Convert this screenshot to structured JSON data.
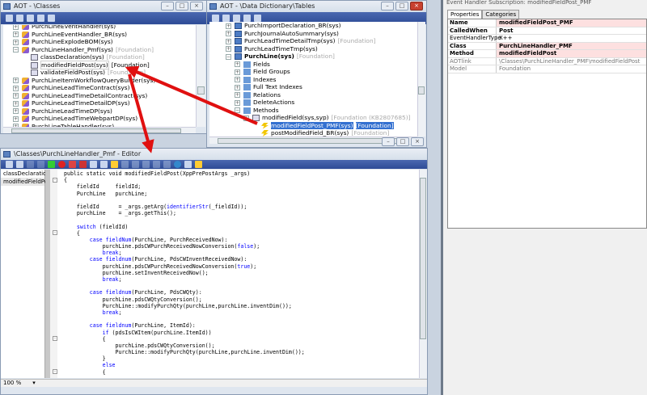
{
  "classes_window": {
    "title": "AOT - \\Classes",
    "items": [
      {
        "label": "PurchLineEventHandler(sys)",
        "layer": "",
        "level": 0,
        "type": "class",
        "expand": "+"
      },
      {
        "label": "PurchLineEventHandler_BR(sys)",
        "layer": "",
        "level": 0,
        "type": "class",
        "expand": "+"
      },
      {
        "label": "PurchLineExplodeBOM(sys)",
        "layer": "",
        "level": 0,
        "type": "class",
        "expand": "+"
      },
      {
        "label": "PurchLineHandler_Pmf(sys)",
        "layer": "[Foundation]",
        "level": 0,
        "type": "class",
        "expand": "-"
      },
      {
        "label": "classDeclaration(sys)",
        "layer": "[Foundation]",
        "level": 1,
        "type": "method",
        "expand": ""
      },
      {
        "label": "modifiedFieldPost(sys)",
        "layer": "[Foundation]",
        "level": 1,
        "type": "method",
        "expand": "",
        "highlight": true
      },
      {
        "label": "validateFieldPost(sys)",
        "layer": "[Foundation]",
        "level": 1,
        "type": "method",
        "expand": ""
      },
      {
        "label": "PurchLineItemWorkflowQueryBuilder(sys)",
        "layer": "",
        "level": 0,
        "type": "class",
        "expand": "+"
      },
      {
        "label": "PurchLineLeadTimeContract(sys)",
        "layer": "",
        "level": 0,
        "type": "class",
        "expand": "+"
      },
      {
        "label": "PurchLineLeadTimeDetailContract(sys)",
        "layer": "",
        "level": 0,
        "type": "class",
        "expand": "+"
      },
      {
        "label": "PurchLineLeadTimeDetailDP(sys)",
        "layer": "",
        "level": 0,
        "type": "class",
        "expand": "+"
      },
      {
        "label": "PurchLineLeadTimeDP(sys)",
        "layer": "",
        "level": 0,
        "type": "class",
        "expand": "+"
      },
      {
        "label": "PurchLineLeadTimeWebpartDP(sys)",
        "layer": "",
        "level": 0,
        "type": "class",
        "expand": "+"
      },
      {
        "label": "PurchLineTableHandler(sys)",
        "layer": "",
        "level": 0,
        "type": "class",
        "expand": "+"
      }
    ]
  },
  "tables_window": {
    "title": "AOT - \\Data Dictionary\\Tables",
    "items": [
      {
        "label": "PurchImportDeclaration_BR(sys)",
        "layer": "",
        "level": 0,
        "type": "table",
        "expand": "+"
      },
      {
        "label": "PurchJournalAutoSummary(sys)",
        "layer": "",
        "level": 0,
        "type": "table",
        "expand": "+"
      },
      {
        "label": "PurchLeadTimeDetailTmp(sys)",
        "layer": "[Foundation]",
        "level": 0,
        "type": "table",
        "expand": "+"
      },
      {
        "label": "PurchLeadTimeTmp(sys)",
        "layer": "",
        "level": 0,
        "type": "table",
        "expand": "+"
      },
      {
        "label": "PurchLine(sys)",
        "layer": "[Foundation]",
        "level": 0,
        "type": "table",
        "expand": "-",
        "bold": true
      },
      {
        "label": "Fields",
        "layer": "",
        "level": 1,
        "type": "node",
        "expand": "+"
      },
      {
        "label": "Field Groups",
        "layer": "",
        "level": 1,
        "type": "node",
        "expand": "+"
      },
      {
        "label": "Indexes",
        "layer": "",
        "level": 1,
        "type": "node",
        "expand": "+"
      },
      {
        "label": "Full Text Indexes",
        "layer": "",
        "level": 1,
        "type": "node",
        "expand": "+"
      },
      {
        "label": "Relations",
        "layer": "",
        "level": 1,
        "type": "node",
        "expand": "+"
      },
      {
        "label": "DeleteActions",
        "layer": "",
        "level": 1,
        "type": "node",
        "expand": "+"
      },
      {
        "label": "Methods",
        "layer": "",
        "level": 1,
        "type": "node",
        "expand": "-"
      },
      {
        "label": "modifiedField(sys,syp)",
        "layer": "[Foundation (KB2807685)]",
        "level": 2,
        "type": "method",
        "expand": "+"
      },
      {
        "label": "modifiedFieldPost_PMF(sys)",
        "layer": "[Foundation]",
        "level": 3,
        "type": "event",
        "expand": "",
        "selected": true
      },
      {
        "label": "postModifiedField_BR(sys)",
        "layer": "[Foundation]",
        "level": 3,
        "type": "event",
        "expand": ""
      }
    ]
  },
  "properties": {
    "title": "Event Handler Subscription: modifiedFieldPost_PMF",
    "tabs": [
      "Properties",
      "Categories"
    ],
    "rows": [
      {
        "key": "Name",
        "value": "modifiedFieldPost_PMF",
        "style": "pink"
      },
      {
        "key": "CalledWhen",
        "value": "Post",
        "style": "bold"
      },
      {
        "key": "EventHandlerType",
        "value": "X++",
        "style": ""
      },
      {
        "key": "Class",
        "value": "PurchLineHandler_PMF",
        "style": "pink"
      },
      {
        "key": "Method",
        "value": "modifiedFieldPost",
        "style": "pink"
      },
      {
        "key": "AOTlink",
        "value": "\\Classes\\PurchLineHandler_PMF\\modifiedFieldPost",
        "style": "grey"
      },
      {
        "key": "Model",
        "value": "Foundation",
        "style": "grey"
      }
    ]
  },
  "editor": {
    "title": "\\Classes\\PurchLineHandler_Pmf - Editor",
    "methods": [
      "classDeclaration",
      "modifiedFieldPost"
    ],
    "zoom": "100 %",
    "code": [
      [
        [
          "",
          "public static void modifiedFieldPost(XppPrePostArgs _args)"
        ]
      ],
      [
        [
          "",
          "{"
        ]
      ],
      [
        [
          "",
          "    fieldId     fieldId;"
        ]
      ],
      [
        [
          "",
          "    PurchLine   purchLine;"
        ]
      ],
      [
        [
          "",
          ""
        ]
      ],
      [
        [
          "",
          "    fieldId      = _args.getArg("
        ],
        [
          "kw",
          "identifierStr"
        ],
        [
          "",
          "(_fieldId));"
        ]
      ],
      [
        [
          "",
          "    purchLine    = _args.getThis();"
        ]
      ],
      [
        [
          "",
          ""
        ]
      ],
      [
        [
          "kw",
          "    switch"
        ],
        [
          "",
          " (fieldId)"
        ]
      ],
      [
        [
          "",
          "    {"
        ]
      ],
      [
        [
          "kw",
          "        case fieldNum"
        ],
        [
          "",
          "(PurchLine, PurchReceivedNow):"
        ]
      ],
      [
        [
          "",
          "            purchLine.pdsCWPurchReceivedNowConversion("
        ],
        [
          "kw",
          "false"
        ],
        [
          "",
          ");"
        ]
      ],
      [
        [
          "kw",
          "            break"
        ],
        [
          "",
          ";"
        ]
      ],
      [
        [
          "kw",
          "        case fieldnum"
        ],
        [
          "",
          "(PurchLine, PdsCWInventReceivedNow):"
        ]
      ],
      [
        [
          "",
          "            purchLine.pdsCWPurchReceivedNowConversion("
        ],
        [
          "kw",
          "true"
        ],
        [
          "",
          ");"
        ]
      ],
      [
        [
          "",
          "            purchLine.setInventReceivedNow();"
        ]
      ],
      [
        [
          "kw",
          "            break"
        ],
        [
          "",
          ";"
        ]
      ],
      [
        [
          "",
          ""
        ]
      ],
      [
        [
          "kw",
          "        case fieldnum"
        ],
        [
          "",
          "(PurchLine, PdsCWQty):"
        ]
      ],
      [
        [
          "",
          "            purchLine.pdsCWQtyConversion();"
        ]
      ],
      [
        [
          "",
          "            PurchLine::modifyPurchQty(purchLine,purchLine.inventDim());"
        ]
      ],
      [
        [
          "kw",
          "            break"
        ],
        [
          "",
          ";"
        ]
      ],
      [
        [
          "",
          ""
        ]
      ],
      [
        [
          "kw",
          "        case fieldnum"
        ],
        [
          "",
          "(PurchLine, ItemId):"
        ]
      ],
      [
        [
          "kw",
          "            if"
        ],
        [
          "",
          " (pdsIsCWItem(purchLine.ItemId))"
        ]
      ],
      [
        [
          "",
          "            {"
        ]
      ],
      [
        [
          "",
          "                purchLine.pdsCWQtyConversion();"
        ]
      ],
      [
        [
          "",
          "                PurchLine::modifyPurchQty(purchLine,purchLine.inventDim());"
        ]
      ],
      [
        [
          "",
          "            }"
        ]
      ],
      [
        [
          "kw",
          "            else"
        ]
      ],
      [
        [
          "",
          "            {"
        ]
      ]
    ]
  },
  "colors": {
    "toolbar": "#2d4b96",
    "selection": "#3370d0",
    "arrow": "#e01010",
    "keyword": "#0000ff"
  }
}
